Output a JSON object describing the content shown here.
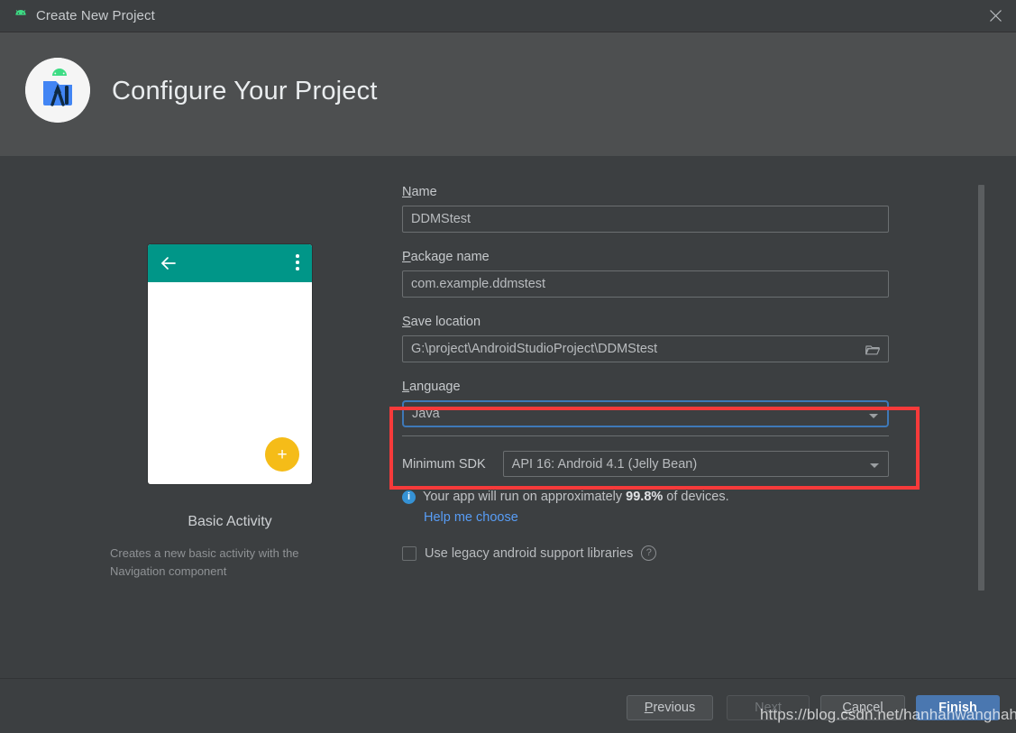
{
  "window": {
    "title": "Create New Project",
    "title_icon": "android-robot-icon",
    "close_icon": "close-icon"
  },
  "header": {
    "title": "Configure Your Project",
    "logo_icon": "android-studio-logo-icon"
  },
  "preview": {
    "template_name": "Basic Activity",
    "description": "Creates a new basic activity with the Navigation component",
    "appbar_color": "#009688",
    "fab_color": "#f5bc18",
    "back_icon": "arrow-back-icon",
    "overflow_icon": "overflow-menu-icon",
    "fab_icon": "plus-icon"
  },
  "form": {
    "name": {
      "label": "Name",
      "mnemonic": "N",
      "rest": "ame",
      "value": "DDMStest"
    },
    "package_name": {
      "label": "Package name",
      "mnemonic": "P",
      "rest": "ackage name",
      "value": "com.example.ddmstest"
    },
    "save_location": {
      "label": "Save location",
      "mnemonic": "S",
      "rest": "ave location",
      "value": "G:\\project\\AndroidStudioProject\\DDMStest",
      "browse_icon": "folder-icon"
    },
    "language": {
      "label": "Language",
      "mnemonic": "L",
      "rest": "anguage",
      "value": "Java",
      "caret_icon": "chevron-down-icon",
      "focus_color": "#3e79b8"
    },
    "minimum_sdk": {
      "label": "Minimum SDK",
      "value": "API 16: Android 4.1 (Jelly Bean)",
      "caret_icon": "chevron-down-icon"
    },
    "device_info": {
      "icon": "info-icon",
      "text_before": "Your app will run on approximately ",
      "percent": "99.8%",
      "text_after": " of devices.",
      "link": "Help me choose"
    },
    "legacy_libraries": {
      "label": "Use legacy android support libraries",
      "checked": false,
      "help_icon": "question-mark-icon",
      "help_glyph": "?"
    }
  },
  "annotation": {
    "color": "#f73a3a",
    "target": "language-field"
  },
  "footer": {
    "buttons": [
      {
        "name": "previous",
        "label": "Previous",
        "mnemonic": "P",
        "rest": "revious",
        "state": "enabled"
      },
      {
        "name": "next",
        "label": "Next",
        "mnemonic": "N",
        "rest": "ext",
        "state": "disabled"
      },
      {
        "name": "cancel",
        "label": "Cancel",
        "mnemonic": "C",
        "rest": "ancel",
        "state": "enabled"
      },
      {
        "name": "finish",
        "label": "Finish",
        "mnemonic": "F",
        "rest": "inish",
        "state": "default"
      }
    ]
  },
  "watermark": {
    "text": "https://blog.csdn.net/hanhanwanghaha"
  }
}
